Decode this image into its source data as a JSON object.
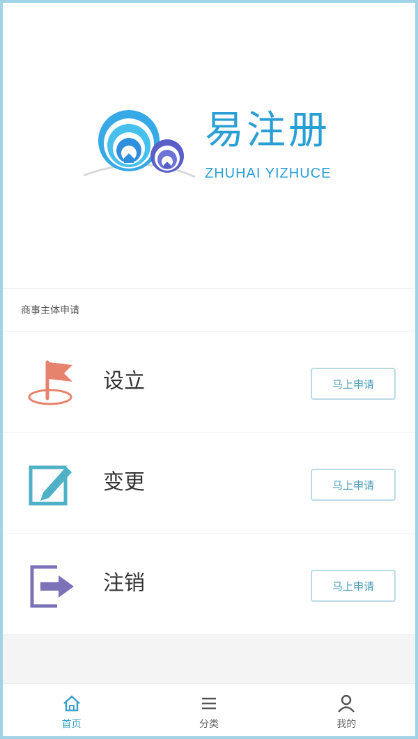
{
  "brand": {
    "title": "易注册",
    "subtitle": "ZHUHAI YIZHUCE"
  },
  "section": {
    "label": "商事主体申请"
  },
  "items": [
    {
      "label": "设立",
      "button": "马上申请",
      "icon": "flag-icon"
    },
    {
      "label": "变更",
      "button": "马上申请",
      "icon": "edit-icon"
    },
    {
      "label": "注销",
      "button": "马上申请",
      "icon": "exit-icon"
    }
  ],
  "nav": [
    {
      "label": "首页",
      "icon": "home-icon",
      "active": true
    },
    {
      "label": "分类",
      "icon": "menu-icon",
      "active": false
    },
    {
      "label": "我的",
      "icon": "user-icon",
      "active": false
    }
  ],
  "colors": {
    "brand": "#2a9fd6",
    "border": "#9fd3e6",
    "button_text": "#4c9cb8",
    "button_border": "#b9dbe5",
    "flag": "#e5836c",
    "edit": "#4fb1c6",
    "exit": "#7b72b8"
  }
}
